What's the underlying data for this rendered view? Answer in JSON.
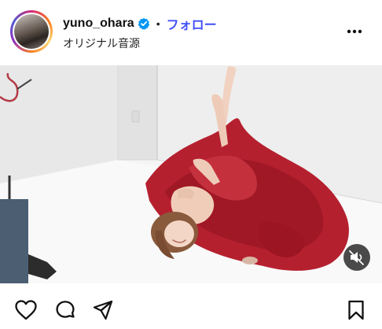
{
  "post": {
    "author": {
      "username": "yuno_ohara",
      "verified": true
    },
    "separator": "•",
    "follow_label": "フォロー",
    "audio_label": "オリジナル音源",
    "media": {
      "type": "video",
      "muted": true
    }
  },
  "icons": {
    "more": "more-horizontal-icon",
    "verified": "verified-badge-icon",
    "mute": "speaker-muted-icon",
    "like": "heart-icon",
    "comment": "comment-bubble-icon",
    "share": "paper-plane-icon",
    "save": "bookmark-icon"
  },
  "colors": {
    "follow": "#4150f7",
    "verified": "#0095f6",
    "dress": "#b5202f"
  }
}
